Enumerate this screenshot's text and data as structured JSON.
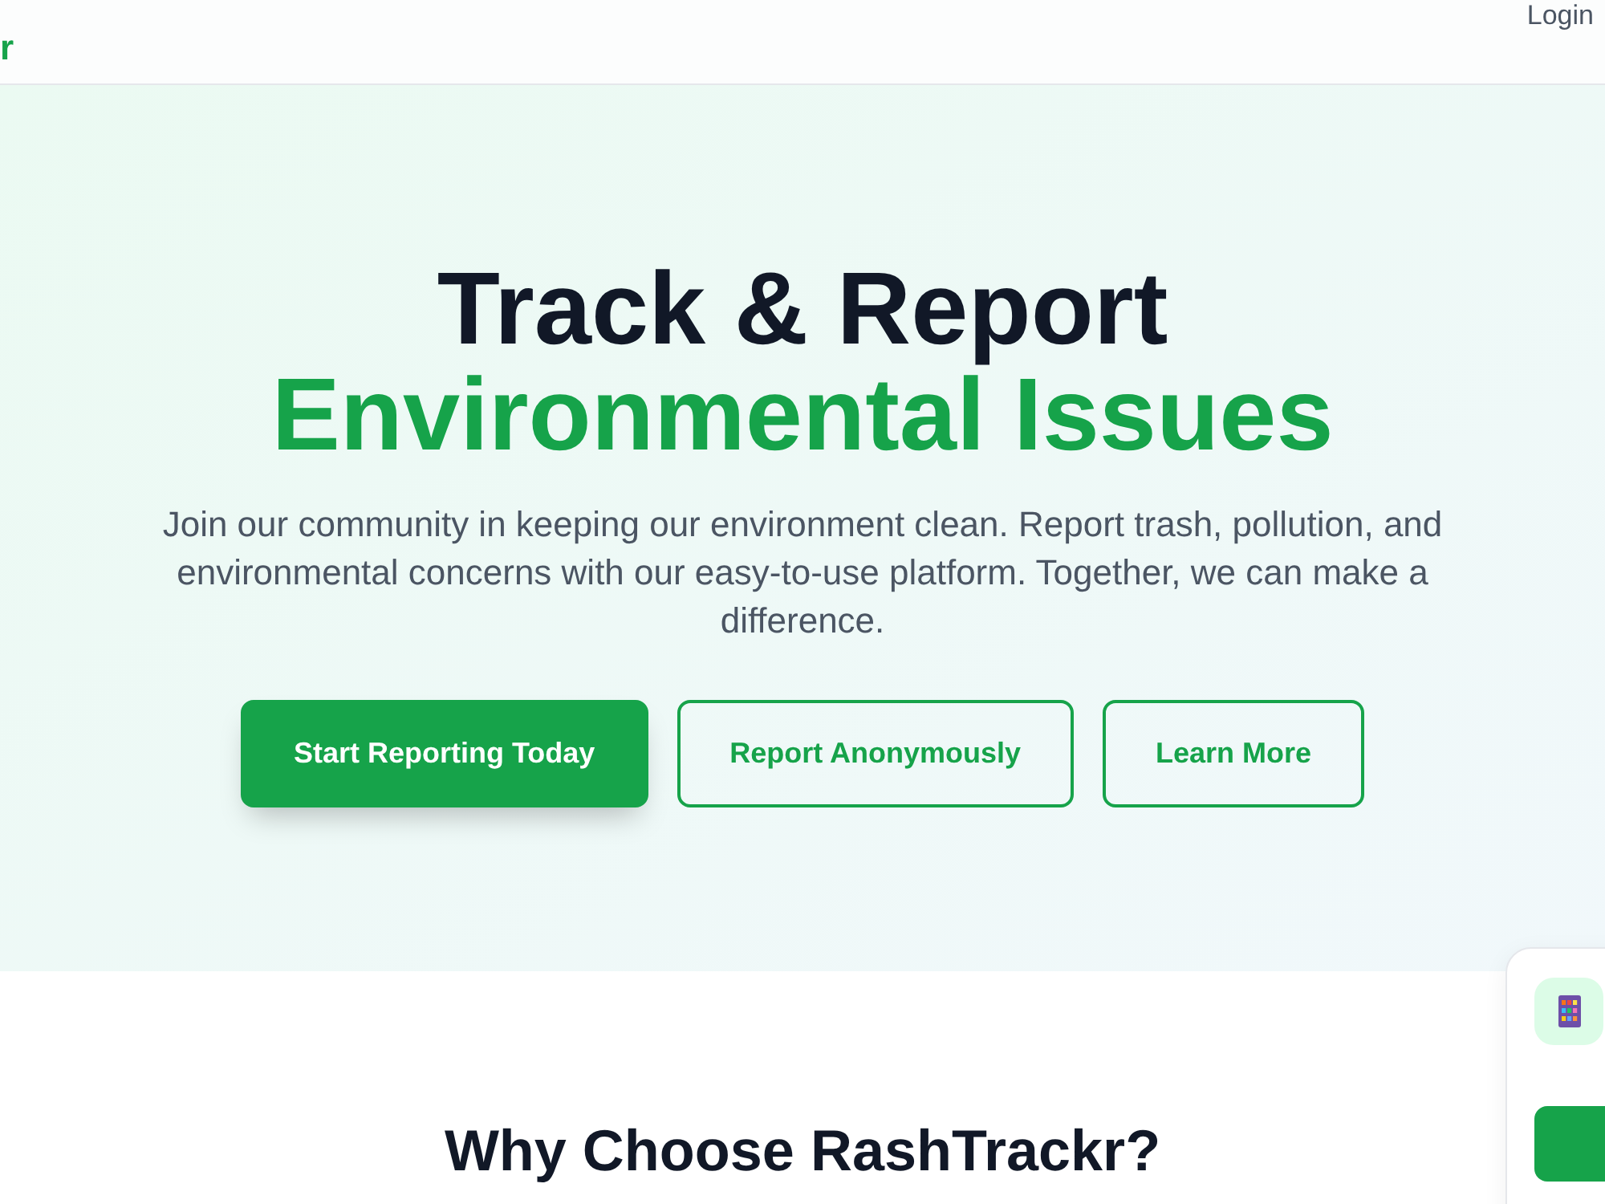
{
  "header": {
    "logo_text": "r",
    "login": "Login"
  },
  "hero": {
    "title_line1": "Track & Report",
    "title_line2": "Environmental Issues",
    "description": "Join our community in keeping our environment clean. Report trash, pollution, and environmental concerns with our easy-to-use platform. Together, we can make a difference.",
    "buttons": [
      {
        "label": "Start Reporting Today",
        "kind": "primary"
      },
      {
        "label": "Report Anonymously",
        "kind": "outline"
      },
      {
        "label": "Learn More",
        "kind": "outline"
      }
    ]
  },
  "features": {
    "heading": "Why Choose RashTrackr?"
  }
}
